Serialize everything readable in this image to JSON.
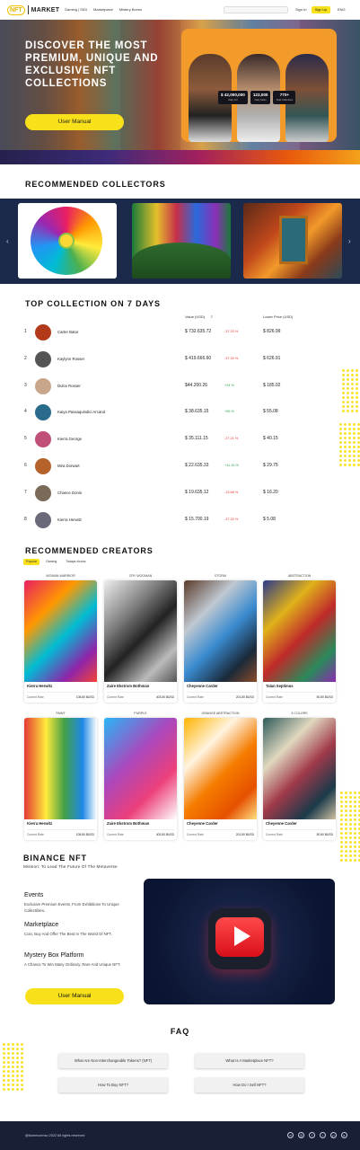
{
  "nav": {
    "logo_badge": "NFT",
    "logo_text": "MARKET",
    "links": [
      "Gaming | SIDI",
      "Marketplace",
      "Mistery Boxes"
    ],
    "search_placeholder": "",
    "signin": "Sign In",
    "signup": "Sign Up",
    "lang": "ENG"
  },
  "hero": {
    "title": "DISCOVER THE MOST PREMIUM, UNIQUE AND EXCLUSIVE NFT COLLECTIONS",
    "button": "User Manual",
    "stats": [
      {
        "value": "$ 42,000,000",
        "label": "Daily Vol"
      },
      {
        "value": "122,000",
        "label": "Daily Sales"
      },
      {
        "value": "770+",
        "label": "Total Collections"
      }
    ]
  },
  "collectors": {
    "title": "RECOMMENDED COLLECTORS"
  },
  "top": {
    "title": "TOP COLLECTION ON 7 DAYS",
    "col_value": "Value (USD)",
    "col_lower": "Lower Price (USD)",
    "rows": [
      {
        "rank": "1",
        "name": "Carter Bator",
        "value": "$ 732.635.72",
        "change": "-37.33 %",
        "low": "$ 826.99",
        "dir": "neg",
        "color": "#b23a1a"
      },
      {
        "rank": "2",
        "name": "Kaylynn Rosser",
        "value": "$ 419.666.60",
        "change": "-37.33 %",
        "low": "$ 626.91",
        "dir": "neg",
        "color": "#555555"
      },
      {
        "rank": "3",
        "name": "Dulce Rosser",
        "value": "$44.200.26",
        "change": "+24 %",
        "low": "$ 185.02",
        "dir": "pos",
        "color": "#c9a58a"
      },
      {
        "rank": "4",
        "name": "Kaiya Passaquindici Arcand",
        "value": "$ 38.635.15",
        "change": "+55 %",
        "low": "$ 55.08",
        "dir": "pos",
        "color": "#2a6a8a"
      },
      {
        "rank": "5",
        "name": "Kierra George",
        "value": "$ 35.111.15",
        "change": "-27.21 %",
        "low": "$ 40.15",
        "dir": "neg",
        "color": "#c0507a"
      },
      {
        "rank": "6",
        "name": "Mira Dorwart",
        "value": "$ 22.635.33",
        "change": "+11.15 %",
        "low": "$ 29.75",
        "dir": "pos",
        "color": "#b5632a"
      },
      {
        "rank": "7",
        "name": "Chance Donin",
        "value": "$ 19.635.12",
        "change": "-13.68 %",
        "low": "$ 16.20",
        "dir": "neg",
        "color": "#7a6a5a"
      },
      {
        "rank": "8",
        "name": "Kierra Herwitz",
        "value": "$ 15.700.19",
        "change": "-37.33 %",
        "low": "$ 5.08",
        "dir": "neg",
        "color": "#6a6a7a"
      }
    ]
  },
  "creators": {
    "title": "RECOMMENDED CREATORS",
    "tabs": [
      "Popular",
      "Gaming",
      "Todays choice"
    ],
    "rate_label": "Current Rate",
    "cards": [
      {
        "caption": "WOMAN WARRIOR",
        "name": "Kierra Herwitz",
        "rate": "108.80 BUSD",
        "bg": "linear-gradient(135deg,#e91e63,#ff9800 30%,#00bcd4 55%,#8e24aa 80%,#f44336)"
      },
      {
        "caption": "CRY WOOMAN",
        "name": "Zaire Ekstrom Bothman",
        "rate": "403.80 BUSD",
        "bg": "linear-gradient(135deg,#eeeeee,#888 30%,#222 55%,#bbb 80%,#555)"
      },
      {
        "caption": "STORM",
        "name": "Cheyenne Carder",
        "rate": "201.80 BUSD",
        "bg": "linear-gradient(135deg,#5a3a2a,#c0c8d0 30%,#3a8ad0 55%,#1a2a3a 80%,#8a4a2a)"
      },
      {
        "caption": "ABSTRACTION",
        "name": "Talan Septimus",
        "rate": "50.80 BUSD",
        "bg": "linear-gradient(135deg,#2a3a8a,#e0b21a 30%,#c02a2a 55%,#2a8a5a 80%,#8a2ab0)"
      },
      {
        "caption": "PAINT",
        "name": "Kierra Herwitz",
        "rate": "108.80 BUSD",
        "bg": "linear-gradient(90deg,#e53935,#ffeb3b 30%,#43a047 55%,#1e88e5 80%,#ffffff)"
      },
      {
        "caption": "PURPLE",
        "name": "Zaire Ekstrom Bothman",
        "rate": "403.80 BUSD",
        "bg": "linear-gradient(135deg,#29b6f6,#ab47bc 40%,#ec407a 70%,#ffffff)"
      },
      {
        "caption": "ORANGE ABSTRACTION",
        "name": "Cheyenne Carder",
        "rate": "201.80 BUSD",
        "bg": "linear-gradient(135deg,#ffb300,#fff3e0 30%,#f57c00 55%,#e65100 80%,#ffe082)"
      },
      {
        "caption": "3 COLORS",
        "name": "Cheyenne Carder",
        "rate": "50.80 BUSD",
        "bg": "linear-gradient(135deg,#2e5a5a,#e0d8c0 30%,#a03a4a 55%,#1a3a4a 80%,#d0c0a0)"
      }
    ]
  },
  "binance": {
    "title": "BINANCE NFT",
    "subtitle": "Mission: To Lead The Future Of The Metaverse",
    "features": [
      {
        "title": "Events",
        "text": "Exclusive Premium Events, From Exhibitions To Unique Collectibles."
      },
      {
        "title": "Marketplace",
        "text": "Coin, Buy And Offer The Best In The World Of NFT."
      },
      {
        "title": "Mystery Box Platform",
        "text": "A Chance To Win Many Ordinary, Rare And Unique NFT."
      }
    ],
    "button": "User Manual"
  },
  "faq": {
    "title": "FAQ",
    "questions": [
      "What Are Non-Interchangeable Tokens? (NFT)",
      "What Is A Marketplace NFT?",
      "How To Buy NFT?",
      "How Do I Sell NFT?"
    ]
  },
  "footer": {
    "copyright": "@tiommunmso 2022 All rights reserved",
    "social_icons": [
      "meta-icon",
      "instagram-icon",
      "facebook-icon",
      "tiktok-icon",
      "pinterest-icon",
      "youtube-icon"
    ]
  }
}
